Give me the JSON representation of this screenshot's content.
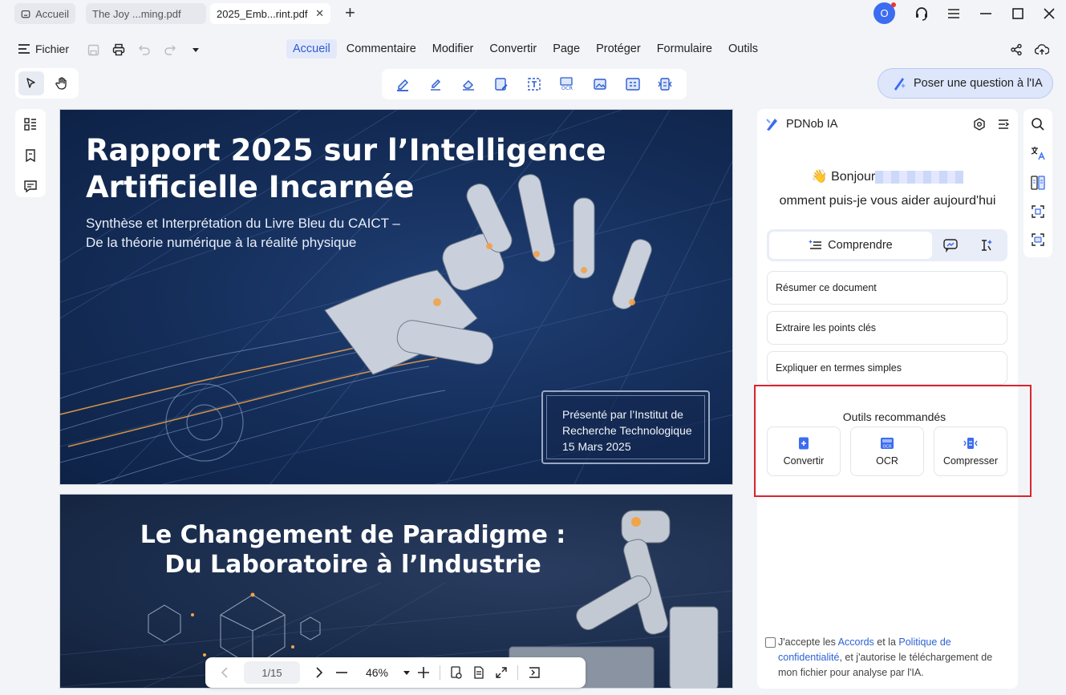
{
  "tabs": [
    {
      "label": "Accueil",
      "icon": "home-icon"
    },
    {
      "label": "The Joy ...ming.pdf"
    },
    {
      "label": "2025_Emb...rint.pdf",
      "close": "✕"
    }
  ],
  "user": {
    "avatar_letter": "O"
  },
  "toolbar": {
    "file_label": "Fichier"
  },
  "menu": [
    "Accueil",
    "Commentaire",
    "Modifier",
    "Convertir",
    "Page",
    "Protéger",
    "Formulaire",
    "Outils"
  ],
  "ask_ai": {
    "label": "Poser une question à l'IA"
  },
  "document": {
    "page1": {
      "title_line1": "Rapport 2025 sur l’Intelligence",
      "title_line2": "Artificielle Incarnée",
      "subtitle_line1": "Synthèse et Interprétation du Livre Bleu du CAICT –",
      "subtitle_line2": "De la théorie numérique à la réalité physique",
      "presenter_line1": "Présenté par l’Institut de",
      "presenter_line2": "Recherche Technologique",
      "presenter_date": "15 Mars 2025"
    },
    "page2": {
      "title_line1": "Le Changement de Paradigme :",
      "title_line2": "Du Laboratoire à l’Industrie"
    }
  },
  "pagenav": {
    "page": "1/15",
    "zoom": "46%"
  },
  "ai_panel": {
    "title": "PDNob IA",
    "greeting": "Bonjour",
    "question": "omment puis-je vous aider aujourd'hui",
    "mode_active": "Comprendre",
    "prompts": [
      "Résumer ce document",
      "Extraire les points clés",
      "Expliquer en termes simples"
    ],
    "recommended_title": "Outils recommandés",
    "tools": [
      "Convertir",
      "OCR",
      "Compresser"
    ],
    "consent": {
      "pre": "J'accepte les ",
      "link1": "Accords",
      "mid": " et la ",
      "link2": "Politique de confidentialité",
      "post": ", et j'autorise le téléchargement de mon fichier pour analyse par l'IA."
    }
  },
  "colors": {
    "accent": "#2d5ccf",
    "highlight_border": "#d9252f",
    "avatar": "#3c6cf0"
  }
}
